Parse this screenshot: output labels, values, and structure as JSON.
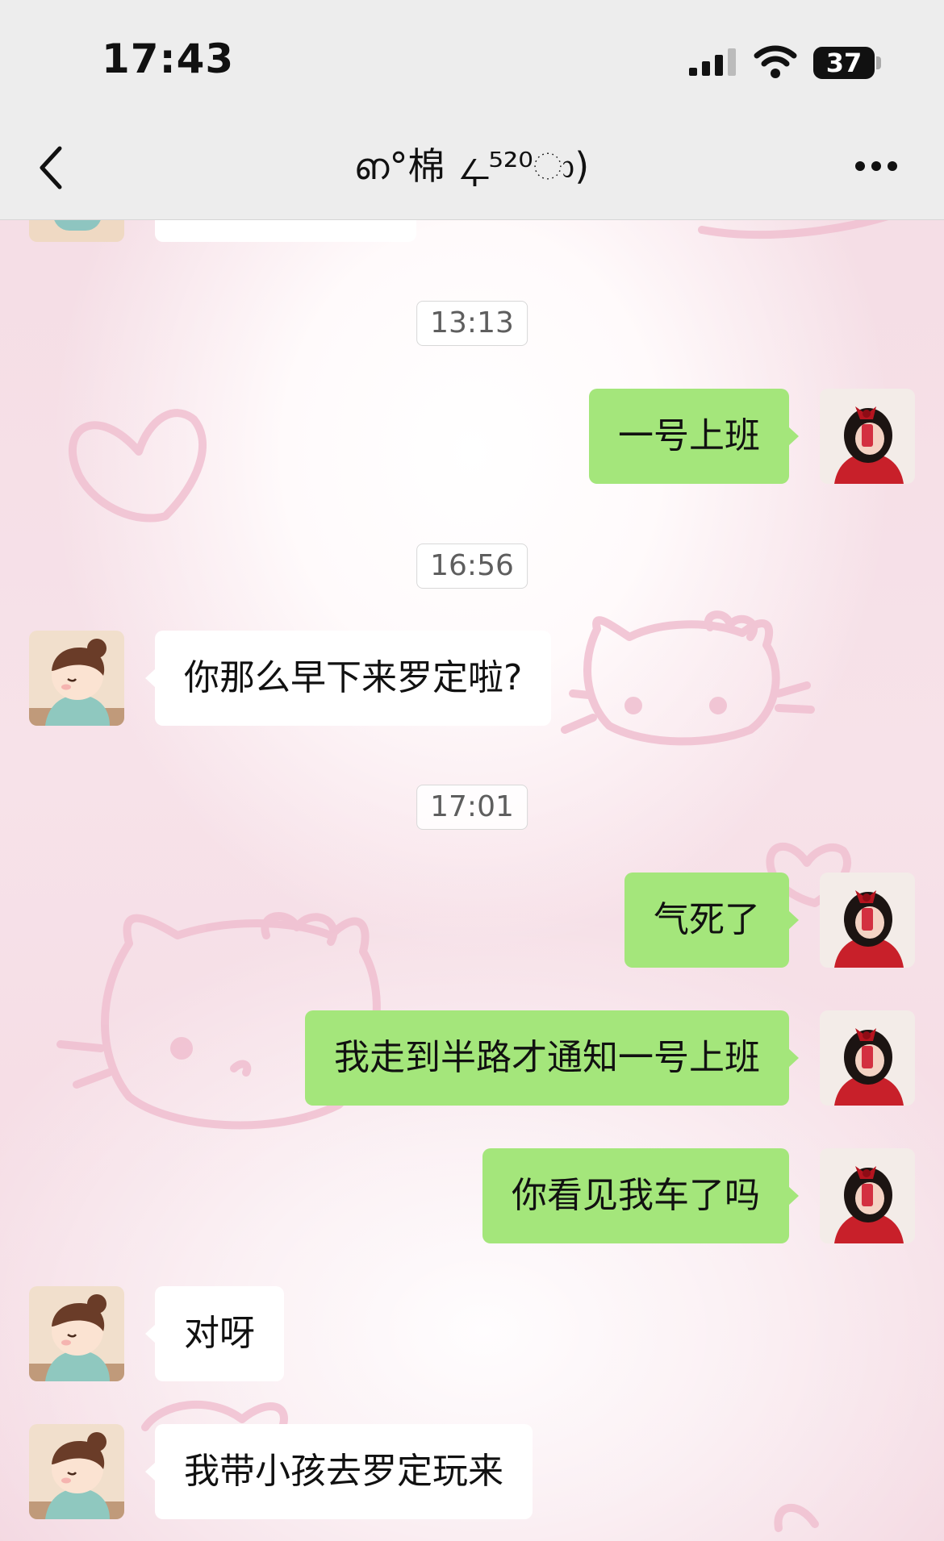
{
  "status_bar": {
    "time": "17:43",
    "battery": "37"
  },
  "nav": {
    "title": "ഩ°棉 ഺ⁵²⁰ා)"
  },
  "messages": [
    {
      "kind": "timestamp",
      "text": "13:13"
    },
    {
      "kind": "out",
      "text": "一号上班"
    },
    {
      "kind": "timestamp",
      "text": "16:56"
    },
    {
      "kind": "in",
      "text": "你那么早下来罗定啦?"
    },
    {
      "kind": "timestamp",
      "text": "17:01"
    },
    {
      "kind": "out",
      "text": "气死了"
    },
    {
      "kind": "out",
      "text": "我走到半路才通知一号上班"
    },
    {
      "kind": "out",
      "text": "你看见我车了吗"
    },
    {
      "kind": "in",
      "text": "对呀"
    },
    {
      "kind": "in",
      "text": "我带小孩去罗定玩来"
    }
  ],
  "colors": {
    "out_bubble": "#a4e67b",
    "in_bubble": "#ffffff",
    "nav_bg": "#ededed"
  },
  "icons": [
    "back-icon",
    "more-icon",
    "signal-icon",
    "wifi-icon",
    "battery-icon"
  ]
}
